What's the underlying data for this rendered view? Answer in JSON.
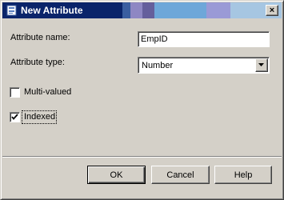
{
  "dialog": {
    "title": "New Attribute",
    "close_glyph": "×"
  },
  "form": {
    "name_label": "Attribute name:",
    "name_value": "EmpID",
    "type_label": "Attribute type:",
    "type_value": "Number",
    "multivalued_label": "Multi-valued",
    "multivalued_checked": false,
    "indexed_label": "Indexed",
    "indexed_checked": true
  },
  "buttons": {
    "ok": "OK",
    "cancel": "Cancel",
    "help": "Help"
  },
  "icons": {
    "title": "attribute-icon",
    "dropdown": "chevron-down-icon",
    "check": "checkmark-icon"
  }
}
